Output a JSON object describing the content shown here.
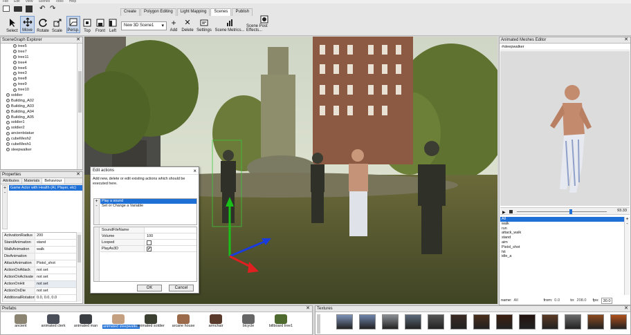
{
  "menu": [
    "File",
    "Edit",
    "View",
    "Scenes",
    "Tools",
    "Help"
  ],
  "toolbar": {
    "left_buttons": [
      "Select",
      "Move",
      "Rotate",
      "Scale"
    ],
    "view_buttons": [
      "Persp.",
      "Top",
      "Front",
      "Left"
    ],
    "tabs": [
      "Create",
      "Polygon Editing",
      "Light Mapping",
      "Scenes",
      "Publish"
    ],
    "active_tab": "Scenes",
    "scene_select": "New 3D Scene1",
    "scene_actions": [
      "Add",
      "Delete",
      "Settings",
      "Scene Metrics...",
      "Scene Post Effects..."
    ]
  },
  "scenegraph": {
    "title": "SceneGraph Explorer",
    "items": [
      "tree5",
      "tree7",
      "tree11",
      "tree4",
      "tree6",
      "tree3",
      "tree8",
      "tree9",
      "tree10",
      "soldier",
      "Building_A02",
      "Building_A03",
      "Building_A04",
      "Building_A05",
      "soldier1",
      "soldier2",
      "ancientstatue",
      "cubeMesh2",
      "cubeMesh1",
      "sleepwalker"
    ]
  },
  "properties": {
    "title": "Properties",
    "tabs": [
      "Attributes",
      "Materials",
      "Behaviour"
    ],
    "active_tab": "Behaviour",
    "behaviour": "Game Actor with Health (AI, Player, etc)",
    "rows": [
      {
        "k": "ActivationRadius",
        "v": "200"
      },
      {
        "k": "StandAnimation",
        "v": "stand"
      },
      {
        "k": "WalkAnimation",
        "v": "walk"
      },
      {
        "k": "DieAnimation",
        "v": ""
      },
      {
        "k": "AttackAnimation",
        "v": "Pistol_shot"
      },
      {
        "k": "ActionOnAttack",
        "v": "not set"
      },
      {
        "k": "ActionOnActivate",
        "v": "not set"
      },
      {
        "k": "ActionOnHit",
        "v": "not set"
      },
      {
        "k": "ActionOnDie",
        "v": "not set"
      },
      {
        "k": "AdditionalRotation",
        "v": "0.0, 0.0, 0.0"
      }
    ]
  },
  "dialog": {
    "title": "Edit actions",
    "description": "Add new, delete or edit existing actions which should be executed here.",
    "actions": [
      "Play a sound",
      "Set or Change a Variable"
    ],
    "props": [
      {
        "k": "SoundFileName",
        "v": "",
        "type": "text"
      },
      {
        "k": "Volume",
        "v": "100",
        "type": "text"
      },
      {
        "k": "Looped",
        "v": "",
        "type": "check"
      },
      {
        "k": "PlayAs3D",
        "v": "✔",
        "type": "check"
      }
    ],
    "ok": "OK",
    "cancel": "Cancel"
  },
  "anim_editor": {
    "title": "Animated Meshes Editor",
    "mesh": "#sleepwalker",
    "slider_value": "93.33",
    "animations": [
      "All",
      "walk",
      "run",
      "attack_walk",
      "stand",
      "aim",
      "Pistol_shot",
      "hit",
      "idle_a"
    ],
    "selected": "All",
    "footer": {
      "name_label": "name:",
      "name": "All",
      "from_label": "from:",
      "from": "0.0",
      "to_label": "to:",
      "to": "208.0",
      "fps_label": "fps:",
      "fps": "30.0"
    }
  },
  "prefabs": {
    "title": "Prefabs",
    "items": [
      "ancient",
      "animated clerk",
      "animated man",
      "animated sleepwalker",
      "animated soldier",
      "arcane house",
      "armchair",
      "bicycle",
      "billboard tree1"
    ],
    "selected": "animated sleepwalker"
  },
  "textures": {
    "title": "Textures"
  },
  "colors": {
    "accent": "#1e6fd6",
    "gizmo_y": "#18c018",
    "gizmo_x": "#e02020",
    "gizmo_z": "#1a3cdc"
  }
}
